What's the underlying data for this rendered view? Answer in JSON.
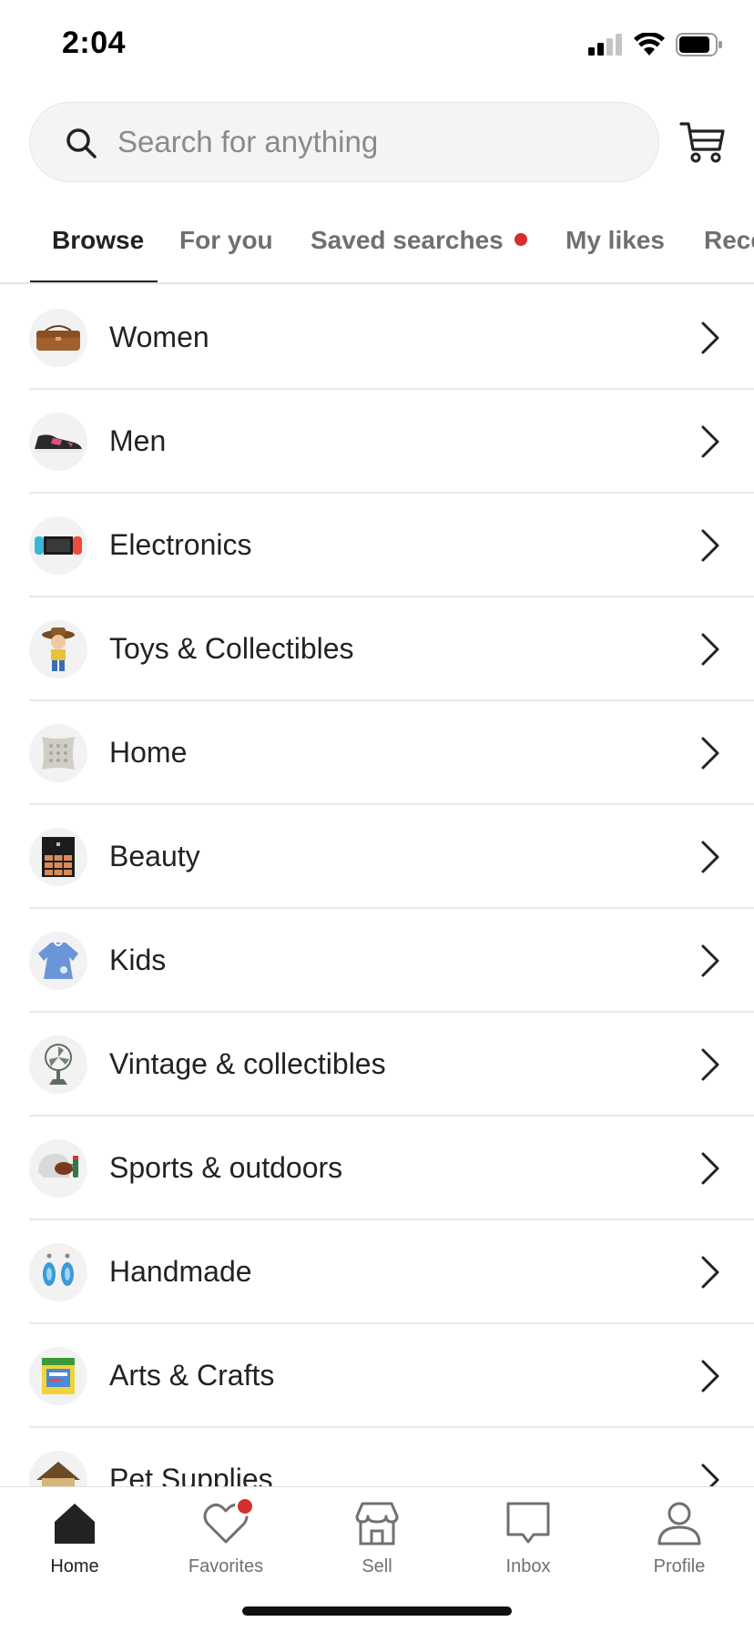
{
  "status_bar": {
    "time": "2:04"
  },
  "search": {
    "placeholder": "Search for anything"
  },
  "tabs": [
    {
      "label": "Browse",
      "active": true
    },
    {
      "label": "For you",
      "active": false
    },
    {
      "label": "Saved searches",
      "active": false,
      "has_dot": true
    },
    {
      "label": "My likes",
      "active": false
    },
    {
      "label": "Rece",
      "active": false
    }
  ],
  "categories": [
    {
      "label": "Women",
      "icon": "handbag-icon"
    },
    {
      "label": "Men",
      "icon": "sneaker-icon"
    },
    {
      "label": "Electronics",
      "icon": "game-console-icon"
    },
    {
      "label": "Toys & Collectibles",
      "icon": "toy-figure-icon"
    },
    {
      "label": "Home",
      "icon": "pillow-icon"
    },
    {
      "label": "Beauty",
      "icon": "palette-icon"
    },
    {
      "label": "Kids",
      "icon": "kids-dress-icon"
    },
    {
      "label": "Vintage & collectibles",
      "icon": "vintage-fan-icon"
    },
    {
      "label": "Sports & outdoors",
      "icon": "football-helmet-icon"
    },
    {
      "label": "Handmade",
      "icon": "earrings-icon"
    },
    {
      "label": "Arts & Crafts",
      "icon": "markers-icon"
    },
    {
      "label": "Pet Supplies",
      "icon": "dog-house-icon"
    }
  ],
  "tab_bar": {
    "items": [
      {
        "label": "Home",
        "icon": "home-icon",
        "active": true
      },
      {
        "label": "Favorites",
        "icon": "heart-icon",
        "active": false,
        "badge": true
      },
      {
        "label": "Sell",
        "icon": "store-icon",
        "active": false
      },
      {
        "label": "Inbox",
        "icon": "chat-bubble-icon",
        "active": false
      },
      {
        "label": "Profile",
        "icon": "person-icon",
        "active": false
      }
    ]
  },
  "colors": {
    "accent_dot": "#d32f2f",
    "text_primary": "#222222",
    "text_secondary": "#707070"
  }
}
